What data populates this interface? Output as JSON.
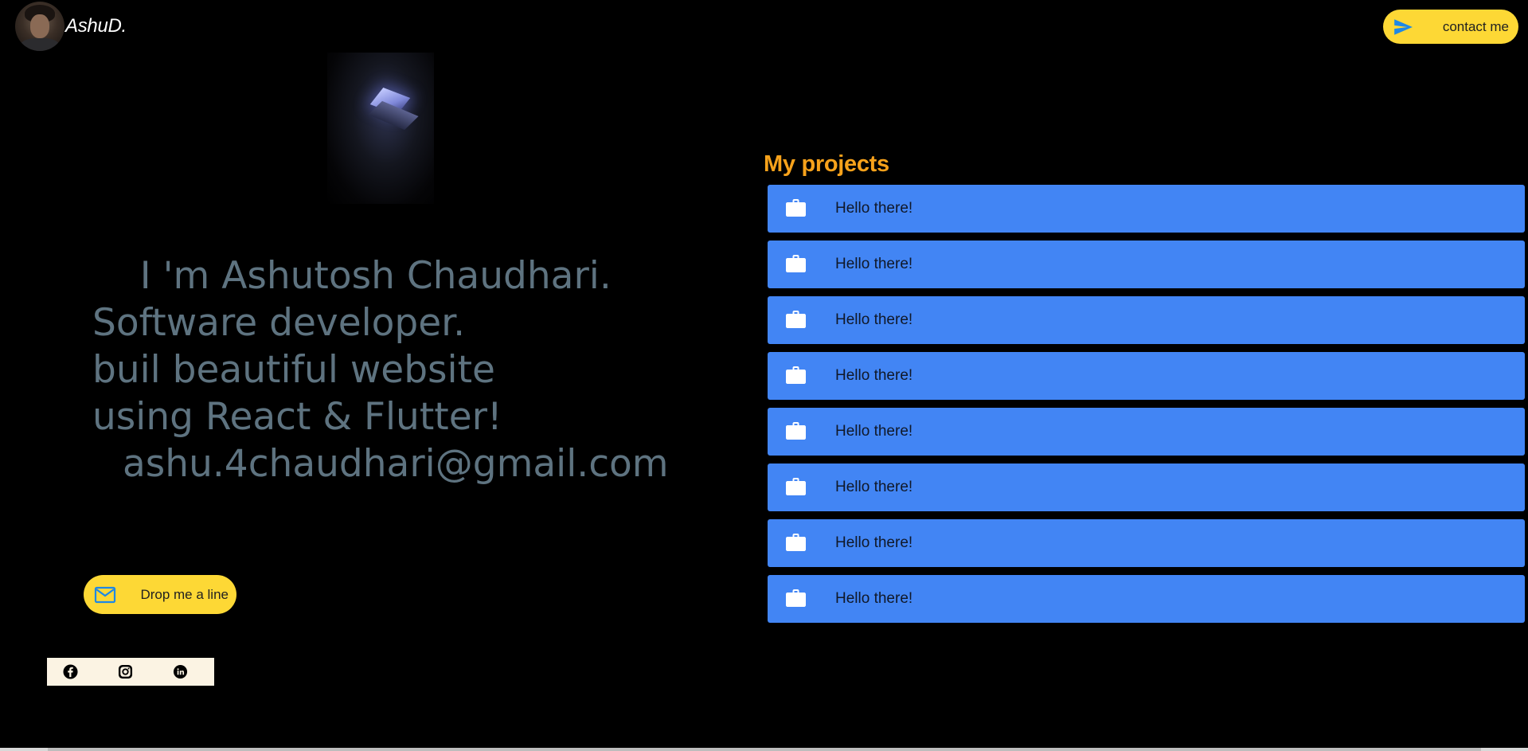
{
  "header": {
    "brand": "AshuD.",
    "contact_label": "contact me"
  },
  "hero": {
    "image_icon": "laptop-dark-photo",
    "lines": [
      "I 'm Ashutosh Chaudhari.",
      "Software developer.",
      "buil beautiful website",
      "using React & Flutter!"
    ],
    "email": "ashu.4chaudhari@gmail.com"
  },
  "cta": {
    "drop_label": "Drop me a line"
  },
  "social": {
    "items": [
      "facebook-icon",
      "instagram-icon",
      "linkedin-icon"
    ]
  },
  "projects": {
    "title": "My projects",
    "items": [
      {
        "label": "Hello there!"
      },
      {
        "label": "Hello there!"
      },
      {
        "label": "Hello there!"
      },
      {
        "label": "Hello there!"
      },
      {
        "label": "Hello there!"
      },
      {
        "label": "Hello there!"
      },
      {
        "label": "Hello there!"
      },
      {
        "label": "Hello there!"
      }
    ]
  },
  "colors": {
    "background": "#000000",
    "accent_yellow": "#fdd835",
    "project_blue": "#4285f4",
    "title_orange": "#f7a21b",
    "intro_text": "#5e7380",
    "send_icon": "#1e88e5"
  }
}
